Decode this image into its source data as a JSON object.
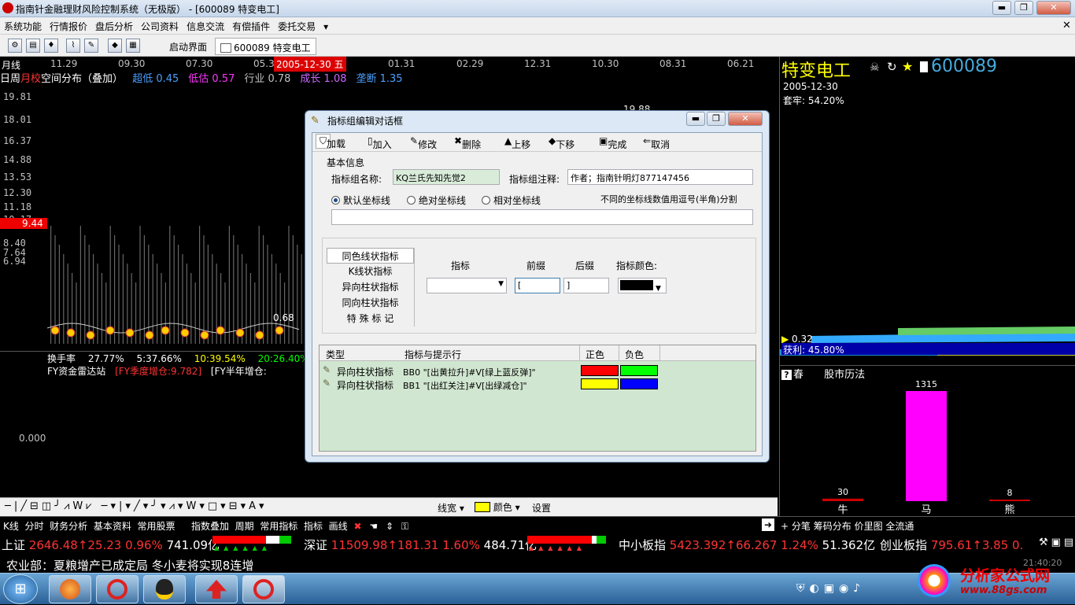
{
  "window": {
    "title": "指南针金融理财风险控制系统（无极版） - [600089 特变电工]",
    "min": "▭",
    "max": "▢",
    "close": "✕"
  },
  "menu": [
    "系统功能",
    "行情报价",
    "盘后分析",
    "公司资料",
    "信息交流",
    "有偿插件",
    "委托交易"
  ],
  "toolbar": {
    "tab_home": "启动界面",
    "tab_stock": "600089 特变电工"
  },
  "chart": {
    "period_label": "月线",
    "dates": [
      "11.29",
      "09.30",
      "07.30",
      "05.3",
      "01.31",
      "02.29",
      "12.31",
      "10.30",
      "08.31",
      "06.21"
    ],
    "current_date": "2005-12-30 五",
    "tabs": [
      "日周",
      "月校"
    ],
    "dist_title": "空间分布（叠加）",
    "dist_items": [
      {
        "label": "超低",
        "value": "0.45",
        "color": "#4aa0ff"
      },
      {
        "label": "低估",
        "value": "0.57",
        "color": "#ff33ff"
      },
      {
        "label": "行业",
        "value": "0.78",
        "color": "#c0c0c0"
      },
      {
        "label": "成长",
        "value": "1.08",
        "color": "#cc66ff"
      },
      {
        "label": "垄断",
        "value": "1.35",
        "color": "#4aa0ff"
      }
    ],
    "y_labels": [
      "19.81",
      "18.01",
      "16.37",
      "14.88",
      "13.53",
      "12.30",
      "11.18",
      "10.17",
      "9.44",
      "8.40",
      "7.64",
      "6.94"
    ],
    "price_marker": "9.44",
    "peak_label": "19.88",
    "low_label": "0.68",
    "turnover": {
      "label": "换手率",
      "v1": "27.77%",
      "v2": "5:37.66%",
      "v3": "10:39.54%",
      "v4": "20:26.40%"
    },
    "radar": {
      "label": "FY资金雷达站",
      "q": "[FY季度增仓:9.782]",
      "h": "[FY半年增仓:"
    },
    "zero": "0.000"
  },
  "right": {
    "name": "特变电工",
    "code": "600089",
    "date": "2005-12-30",
    "trap": "套牢: 54.20%",
    "low_val": "0.32",
    "profit": "获利: 45.80%",
    "calendar_label": "春",
    "calendar_title": "股市历法",
    "bars": [
      {
        "label": "牛",
        "value": 30
      },
      {
        "label": "马",
        "value": 1315
      },
      {
        "label": "熊",
        "value": 8
      }
    ]
  },
  "dialog": {
    "title": "指标组编辑对话框",
    "buttons": [
      "加载",
      "加入",
      "修改",
      "删除",
      "上移",
      "下移",
      "完成",
      "取消"
    ],
    "section": "基本信息",
    "name_label": "指标组名称:",
    "name_value": "KQ兰氏先知先觉2",
    "note_label": "指标组注释:",
    "note_value": "作者；指南针明灯877147456",
    "radios": [
      "默认坐标线",
      "绝对坐标线",
      "相对坐标线"
    ],
    "radio_hint": "不同的坐标线数值用逗号(半角)分割",
    "types": [
      "同色线状指标",
      "K线状指标",
      "异向柱状指标",
      "同向柱状指标",
      "特 殊 标 记"
    ],
    "col_indicator": "指标",
    "col_prefix": "前缀",
    "col_suffix": "后缀",
    "col_color": "指标颜色:",
    "prefix_value": "[",
    "suffix_value": "]",
    "table_headers": [
      "类型",
      "指标与提示行",
      "正色",
      "负色"
    ],
    "rows": [
      {
        "type": "异向柱状指标",
        "text": "BB0 \"[出黄拉升]#V[绿上蓝反弹]\"",
        "pos": "#ff0000",
        "neg": "#00ff00"
      },
      {
        "type": "异向柱状指标",
        "text": "BB1 \"[出红关注]#V[出绿减仓]\"",
        "pos": "#ffff00",
        "neg": "#0000ff"
      }
    ]
  },
  "drawbar": {
    "width_label": "线宽",
    "color_label": "颜色",
    "settings": "设置"
  },
  "funcbar": {
    "left": [
      "K线",
      "分时",
      "财务分析",
      "基本资料",
      "常用股票"
    ],
    "mid": [
      "指数叠加",
      "周期",
      "常用指标",
      "指标",
      "画线"
    ],
    "right": [
      "分笔",
      "筹码分布",
      "价里图",
      "全流通"
    ]
  },
  "indexes": [
    {
      "name": "上证",
      "value": "2646.48",
      "chg": "↑25.23",
      "pct": "0.96%",
      "amt": "741.09亿"
    },
    {
      "name": "深证",
      "value": "11509.98",
      "chg": "↑181.31",
      "pct": "1.60%",
      "amt": "484.71亿"
    },
    {
      "name": "中小板指",
      "value": "5423.392",
      "chg": "↑66.267",
      "pct": "1.24%",
      "amt": "51.362亿"
    },
    {
      "name": "创业板指",
      "value": "795.61",
      "chg": "↑3.85",
      "pct": "0.",
      "amt": ""
    }
  ],
  "news": "农业部：夏粮增产已成定局 冬小麦将实现8连增",
  "clock": "21:40:20",
  "watermark": {
    "text": "分析家公式网",
    "url": "www.88gs.com"
  }
}
